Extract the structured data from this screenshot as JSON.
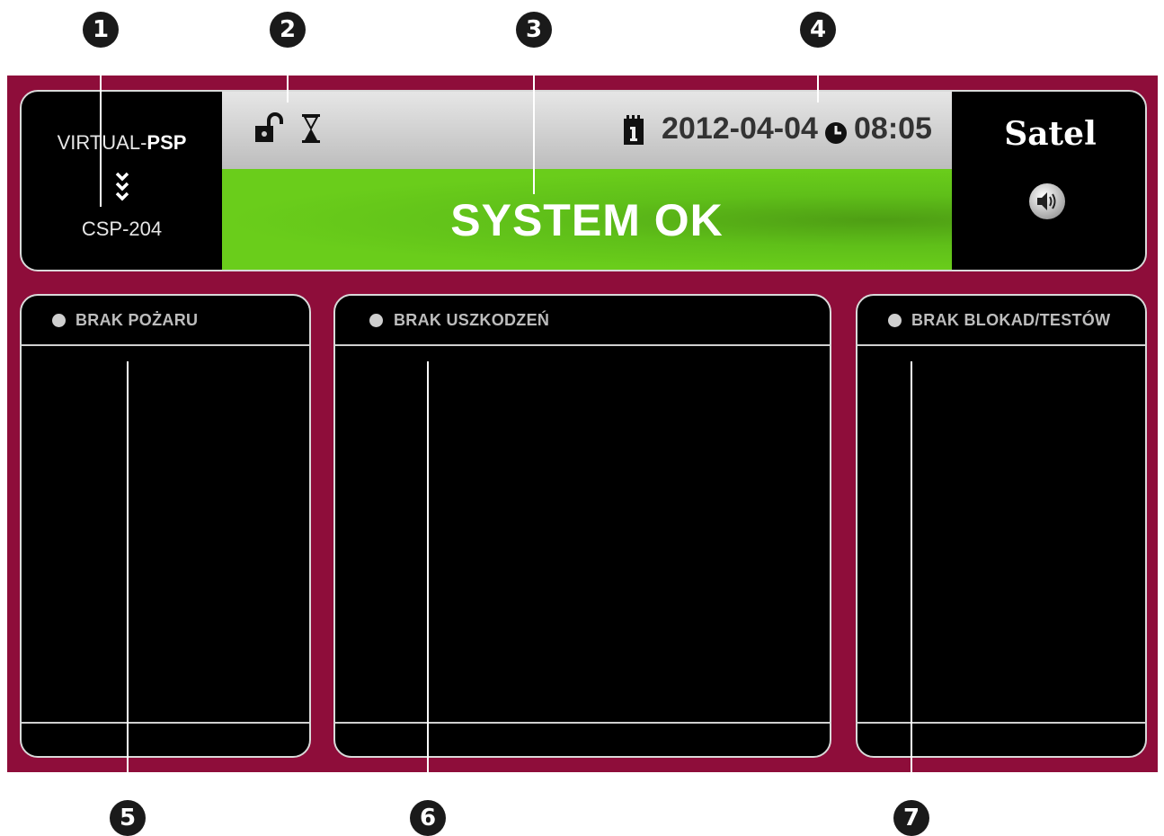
{
  "callouts": [
    "1",
    "2",
    "3",
    "4",
    "5",
    "6",
    "7"
  ],
  "header": {
    "device_name_prefix": "VIRTUAL-",
    "device_name_suffix": "PSP",
    "device_model": "CSP-204",
    "date": "2012-04-04",
    "time": "08:05",
    "status": "SYSTEM OK",
    "brand": "Satel",
    "icons": [
      "unlock-icon",
      "hourglass-icon",
      "calendar-icon",
      "clock-icon",
      "speaker-icon",
      "chevrons-down-icon"
    ]
  },
  "columns": [
    {
      "title": "BRAK POŻARU"
    },
    {
      "title": "BRAK USZKODZEŃ"
    },
    {
      "title": "BRAK BLOKAD/TESTÓW"
    }
  ],
  "colors": {
    "frame": "#8e0d3a",
    "status_ok": "#6acd1b",
    "status_bar": "#cfcfcf",
    "panel": "#000000"
  }
}
